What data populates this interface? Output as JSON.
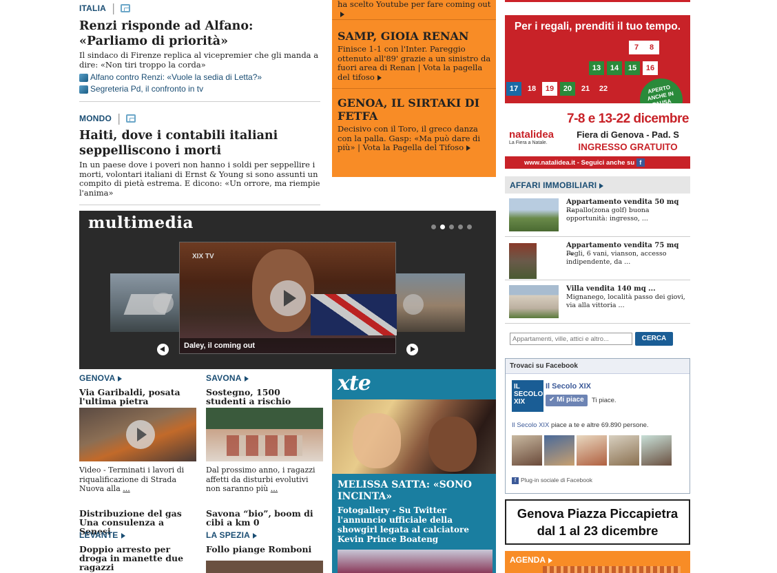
{
  "colors": {
    "accent": "#1a4d73",
    "orange": "#f88c26",
    "teal": "#1a7ea0",
    "dark": "#222222",
    "red": "#cc2229"
  },
  "left": {
    "a1": {
      "section": "ITALIA",
      "title": "Renzi risponde ad Alfano: «Parliamo di priorità»",
      "desc": "Il sindaco di Firenze replica al vicepremier che gli manda a dire: «Non tiri troppo la corda»",
      "related": [
        "Alfano contro Renzi: «Vuole la sedia di Letta?»",
        "Segreteria Pd, il confronto in tv"
      ]
    },
    "a2": {
      "section": "MONDO",
      "title": "Haiti, dove i contabili italiani seppelliscono i morti",
      "desc": "In un paese dove i poveri non hanno i soldi per seppellire i morti, volontari italiani di Ernst & Young si sono assunti un compito di pietà estrema. E dicono: «Un orrore, ma riempie l'anima»"
    }
  },
  "orange": {
    "top": "ha scelto Youtube per fare coming out",
    "b1": {
      "title": "SAMP, GIOIA RENAN",
      "desc": "Finisce 1-1 con l'Inter. Pareggio ottenuto all'89' grazie a un sinistro da fuori area di Renan | Vota la pagella del tifoso"
    },
    "b2": {
      "title": "GENOA, IL SIRTAKI DI FETFA",
      "desc": "Decisivo con il Toro, il greco danza con la palla. Gasp: «Ma può dare di più» | Vota la Pagella del Tifoso"
    }
  },
  "multimedia": {
    "logo": "multimedia",
    "caption": "Daley, il coming out",
    "tv": "XIX TV"
  },
  "locals": {
    "genova": {
      "section": "GENOVA",
      "title": "Via Garibaldi, posata l'ultima pietra",
      "desc": "Video - Terminati i lavori di riqualificazione di Strada Nuova alla",
      "more": "...",
      "title2": "Distribuzione del gas Una consulenza a Senesi"
    },
    "savona": {
      "section": "SAVONA",
      "title": "Sostegno, 1500 studenti a rischio",
      "desc": "Dal prossimo anno, i ragazzi affetti da disturbi evolutivi non saranno più",
      "more": "...",
      "title2": "Savona “bio”, boom di cibi a km 0"
    },
    "levante": {
      "section": "LEVANTE",
      "title": "Doppio arresto per droga in manette due ragazzi"
    },
    "laspezia": {
      "section": "LA SPEZIA",
      "title": "Follo piange Romboni"
    }
  },
  "xte": {
    "logo": "xte",
    "title": "MELISSA SATTA: «SONO INCINTA»",
    "desc": "Fotogallery - Su Twitter l'annuncio ufficiale della showgirl legata al calciatore Kevin Prince Boateng"
  },
  "ad": {
    "headline": "Per i regali, prenditi il tuo tempo.",
    "brand": "natalidea",
    "brand_sub": "La Fiera a Natale.",
    "dates": "7-8 e 13-22 dicembre",
    "place": "Fiera di Genova - Pad. S",
    "free": "INGRESSO GRATUITO",
    "url": "www.natalidea.it - Seguici anche su",
    "badge": "APERTO ANCHE IN PAUSA PRANZO!",
    "numbers": [
      "7",
      "8",
      "13",
      "14",
      "15",
      "16",
      "17",
      "18",
      "19",
      "20",
      "21",
      "22"
    ]
  },
  "affari": {
    "heading": "AFFARI IMMOBILIARI",
    "items": [
      {
        "title": "Appartamento vendita 50 mq ...",
        "desc": "Rapallo(zona golf) buona opportunità: ingresso, ..."
      },
      {
        "title": "Appartamento vendita 75 mq ...",
        "desc": "Pegli, 6 vani, vianson, accesso indipendente, da ..."
      },
      {
        "title": "Villa vendita 140 mq ...",
        "desc": "Mignanego, località passo dei giovi, via alla vittoria ..."
      }
    ],
    "search_placeholder": "Appartamenti, ville, attici e altro...",
    "search_button": "CERCA"
  },
  "facebook": {
    "heading": "Trovaci su Facebook",
    "page": "Il Secolo XIX",
    "logo": "IL SECOLO XIX",
    "like": "Mi piace",
    "like_note": "Ti piace.",
    "likes_text": "piace a te e altre 69.890 persone.",
    "plugin": "Plug-in sociale di Facebook"
  },
  "piazza": {
    "line1": "Genova Piazza Piccapietra",
    "line2": "dal 1 al 23 dicembre"
  },
  "agenda": {
    "heading": "AGENDA"
  }
}
